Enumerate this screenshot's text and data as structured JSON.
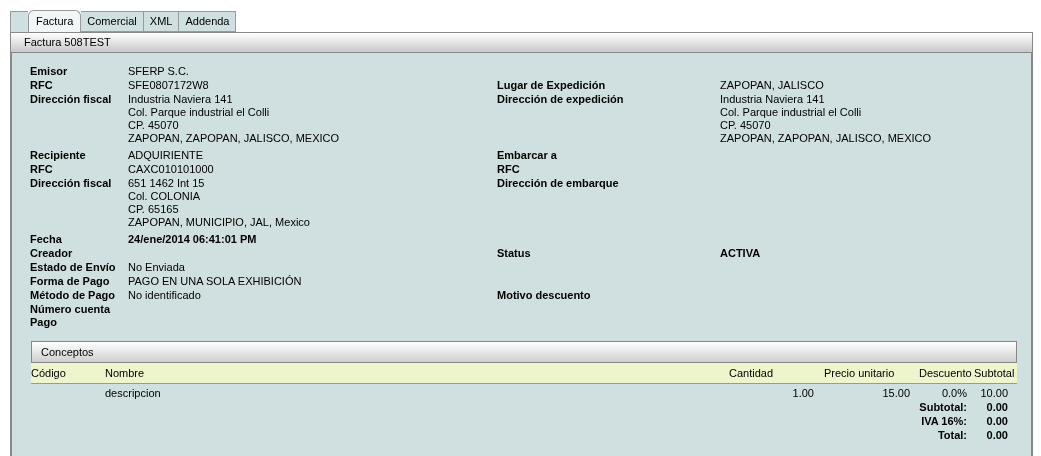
{
  "tabs": [
    {
      "label": "Factura",
      "selected": true
    },
    {
      "label": "Comercial",
      "selected": false
    },
    {
      "label": "XML",
      "selected": false
    },
    {
      "label": "Addenda",
      "selected": false
    }
  ],
  "panel_title": "Factura 508TEST",
  "field_groups": [
    {
      "rows": [
        {
          "left": {
            "label": "Emisor",
            "lines": [
              "SFERP S.C."
            ]
          }
        },
        {
          "left": {
            "label": "RFC",
            "lines": [
              "SFE0807172W8"
            ]
          },
          "right": {
            "label": "Lugar de Expedición",
            "lines": [
              "ZAPOPAN, JALISCO"
            ]
          }
        },
        {
          "left": {
            "label": "Dirección fiscal",
            "lines": [
              "Industria Naviera 141",
              "Col. Parque industrial el Colli",
              "CP. 45070",
              "ZAPOPAN, ZAPOPAN, JALISCO, MEXICO"
            ]
          },
          "right": {
            "label": "Dirección de expedición",
            "lines": [
              "Industria Naviera 141",
              "Col. Parque industrial el Colli",
              "CP. 45070",
              "ZAPOPAN, ZAPOPAN, JALISCO, MEXICO"
            ]
          }
        }
      ]
    },
    {
      "rows": [
        {
          "left": {
            "label": "Recipiente",
            "lines": [
              "ADQUIRIENTE"
            ]
          },
          "right": {
            "label": "Embarcar a"
          }
        },
        {
          "left": {
            "label": "RFC",
            "lines": [
              "CAXC010101000"
            ]
          },
          "right": {
            "label": "RFC"
          }
        },
        {
          "left": {
            "label": "Dirección fiscal",
            "lines": [
              "651 1462 Int 15",
              "Col. COLONIA",
              "CP. 65165",
              "ZAPOPAN, MUNICIPIO, JAL, Mexico"
            ]
          },
          "right": {
            "label": "Dirección de embarque"
          }
        }
      ]
    },
    {
      "rows": [
        {
          "left": {
            "label": "Fecha",
            "lines": [
              "24/ene/2014 06:41:01 PM"
            ],
            "emphasized": true
          }
        },
        {
          "left": {
            "label": "Creador"
          },
          "right": {
            "label": "Status",
            "lines": [
              "ACTIVA"
            ],
            "emphasized": true
          }
        },
        {
          "left": {
            "label": "Estado de Envío",
            "lines": [
              "No Enviada"
            ]
          }
        },
        {
          "left": {
            "label": "Forma de Pago",
            "lines": [
              "PAGO EN UNA SOLA EXHIBICIÓN"
            ]
          }
        },
        {
          "left": {
            "label": "Método de Pago",
            "lines": [
              "No identificado"
            ]
          },
          "right": {
            "label": "Motivo descuento"
          }
        },
        {
          "left": {
            "label": "Número cuenta Pago"
          }
        }
      ]
    }
  ],
  "concepts": {
    "title": "Conceptos",
    "columns": [
      "Código",
      "Nombre",
      "Cantidad",
      "Precio unitario",
      "Descuento",
      "Subtotal"
    ],
    "rows": [
      {
        "nombre": "descripcion",
        "cantidad": "1.00",
        "precio_unitario": "15.00",
        "descuento": "0.0%",
        "subtotal": "10.00"
      }
    ],
    "totals": [
      {
        "label": "Subtotal:",
        "value": "0.00"
      },
      {
        "label": "IVA 16%:",
        "value": "0.00"
      },
      {
        "label": "Total:",
        "value": "0.00"
      }
    ]
  }
}
